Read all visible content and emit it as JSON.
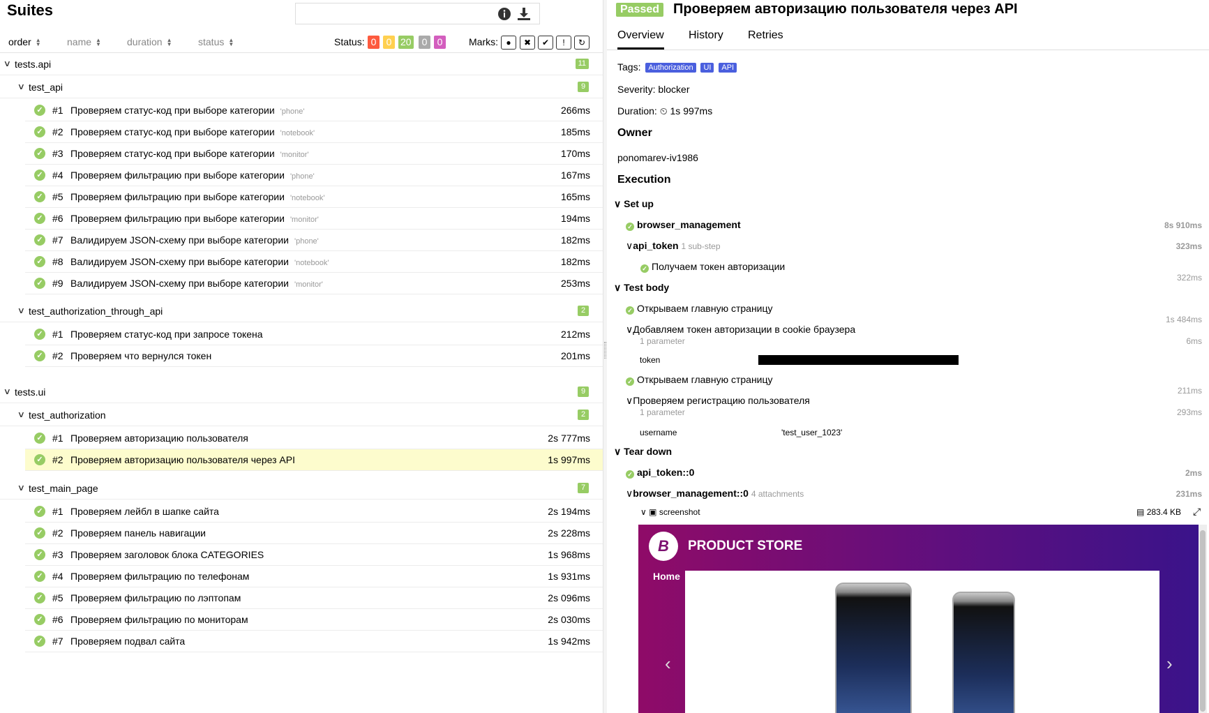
{
  "suites": {
    "title": "Suites",
    "search_placeholder": "",
    "sort": [
      {
        "label": "order",
        "active": true
      },
      {
        "label": "name",
        "active": false
      },
      {
        "label": "duration",
        "active": false
      },
      {
        "label": "status",
        "active": false
      }
    ],
    "status_label": "Status:",
    "status_counts": [
      {
        "value": "0",
        "color": "#fd5a3e"
      },
      {
        "value": "0",
        "color": "#ffd050"
      },
      {
        "value": "20",
        "color": "#97cc64"
      },
      {
        "value": "0",
        "color": "#aaaaaa"
      },
      {
        "value": "0",
        "color": "#d35ebe"
      }
    ],
    "marks_label": "Marks:",
    "marks": [
      {
        "icon": "bomb-icon",
        "glyph": "●"
      },
      {
        "icon": "x-circle-icon",
        "glyph": "✖"
      },
      {
        "icon": "check-circle-icon",
        "glyph": "✔"
      },
      {
        "icon": "info-circle-icon",
        "glyph": "!"
      },
      {
        "icon": "retry-icon",
        "glyph": "↻"
      }
    ],
    "groups": [
      {
        "name": "tests.api",
        "count": "11",
        "children": [
          {
            "name": "test_api",
            "count": "9",
            "tests": [
              {
                "num": "#1",
                "name": "Проверяем статус-код при выборе категории",
                "param": "'phone'",
                "duration": "266ms"
              },
              {
                "num": "#2",
                "name": "Проверяем статус-код при выборе категории",
                "param": "'notebook'",
                "duration": "185ms"
              },
              {
                "num": "#3",
                "name": "Проверяем статус-код при выборе категории",
                "param": "'monitor'",
                "duration": "170ms"
              },
              {
                "num": "#4",
                "name": "Проверяем фильтрацию при выборе категории",
                "param": "'phone'",
                "duration": "167ms"
              },
              {
                "num": "#5",
                "name": "Проверяем фильтрацию при выборе категории",
                "param": "'notebook'",
                "duration": "165ms"
              },
              {
                "num": "#6",
                "name": "Проверяем фильтрацию при выборе категории",
                "param": "'monitor'",
                "duration": "194ms"
              },
              {
                "num": "#7",
                "name": "Валидируем JSON-схему при выборе категории",
                "param": "'phone'",
                "duration": "182ms"
              },
              {
                "num": "#8",
                "name": "Валидируем JSON-схему при выборе категории",
                "param": "'notebook'",
                "duration": "182ms"
              },
              {
                "num": "#9",
                "name": "Валидируем JSON-схему при выборе категории",
                "param": "'monitor'",
                "duration": "253ms"
              }
            ]
          },
          {
            "name": "test_authorization_through_api",
            "count": "2",
            "tests": [
              {
                "num": "#1",
                "name": "Проверяем статус-код при запросе токена",
                "param": "",
                "duration": "212ms"
              },
              {
                "num": "#2",
                "name": "Проверяем что вернулся токен",
                "param": "",
                "duration": "201ms"
              }
            ]
          }
        ]
      },
      {
        "name": "tests.ui",
        "count": "9",
        "children": [
          {
            "name": "test_authorization",
            "count": "2",
            "tests": [
              {
                "num": "#1",
                "name": "Проверяем авторизацию пользователя",
                "param": "",
                "duration": "2s 777ms"
              },
              {
                "num": "#2",
                "name": "Проверяем авторизацию пользователя через API",
                "param": "",
                "duration": "1s 997ms",
                "selected": true
              }
            ]
          },
          {
            "name": "test_main_page",
            "count": "7",
            "tests": [
              {
                "num": "#1",
                "name": "Проверяем лейбл в шапке сайта",
                "param": "",
                "duration": "2s 194ms"
              },
              {
                "num": "#2",
                "name": "Проверяем панель навигации",
                "param": "",
                "duration": "2s 228ms"
              },
              {
                "num": "#3",
                "name": "Проверяем заголовок блока CATEGORIES",
                "param": "",
                "duration": "1s 968ms"
              },
              {
                "num": "#4",
                "name": "Проверяем фильтрацию по телефонам",
                "param": "",
                "duration": "1s 931ms"
              },
              {
                "num": "#5",
                "name": "Проверяем фильтрацию по лэптопам",
                "param": "",
                "duration": "2s 096ms"
              },
              {
                "num": "#6",
                "name": "Проверяем фильтрацию по мониторам",
                "param": "",
                "duration": "2s 030ms"
              },
              {
                "num": "#7",
                "name": "Проверяем подвал сайта",
                "param": "",
                "duration": "1s 942ms"
              }
            ]
          }
        ]
      }
    ]
  },
  "detail": {
    "status": "Passed",
    "status_color": "#97cc64",
    "title": "Проверяем авторизацию пользователя через API",
    "tabs": [
      {
        "label": "Overview",
        "active": true
      },
      {
        "label": "History",
        "active": false
      },
      {
        "label": "Retries",
        "active": false
      }
    ],
    "tags_label": "Tags:",
    "tags": [
      "Authorization",
      "UI",
      "API"
    ],
    "tag_color": "#4a5fde",
    "severity": "Severity: blocker",
    "duration_label": "Duration:",
    "duration_value": "1s 997ms",
    "owner_heading": "Owner",
    "owner": "ponomarev-iv1986",
    "execution_heading": "Execution",
    "setup": {
      "title": "Set up",
      "browser_management": {
        "name": "browser_management",
        "duration": "8s 910ms"
      },
      "api_token": {
        "name": "api_token",
        "sub": "1 sub-step",
        "duration": "323ms"
      },
      "get_token": {
        "name": "Получаем токен авторизации",
        "duration": "322ms"
      }
    },
    "body": {
      "title": "Test body",
      "step1": {
        "name": "Открываем главную страницу",
        "duration": "1s 484ms"
      },
      "step2": {
        "name": "Добавляем токен авторизации в cookie браузера",
        "sub": "1 parameter",
        "duration": "6ms",
        "param_name": "token"
      },
      "step3": {
        "name": "Открываем главную страницу",
        "duration": "211ms"
      },
      "step4": {
        "name": "Проверяем регистрацию пользователя",
        "sub": "1 parameter",
        "duration": "293ms",
        "param_name": "username",
        "param_value": "'test_user_1023'"
      }
    },
    "teardown": {
      "title": "Tear down",
      "api_token": {
        "name": "api_token::0",
        "duration": "2ms"
      },
      "browser_management": {
        "name": "browser_management::0",
        "sub": "4 attachments",
        "duration": "231ms"
      },
      "attachment": {
        "name": "screenshot",
        "size": "283.4 KB"
      }
    },
    "screenshot": {
      "logo": "B",
      "brand": "PRODUCT STORE",
      "nav_home": "Home"
    }
  }
}
